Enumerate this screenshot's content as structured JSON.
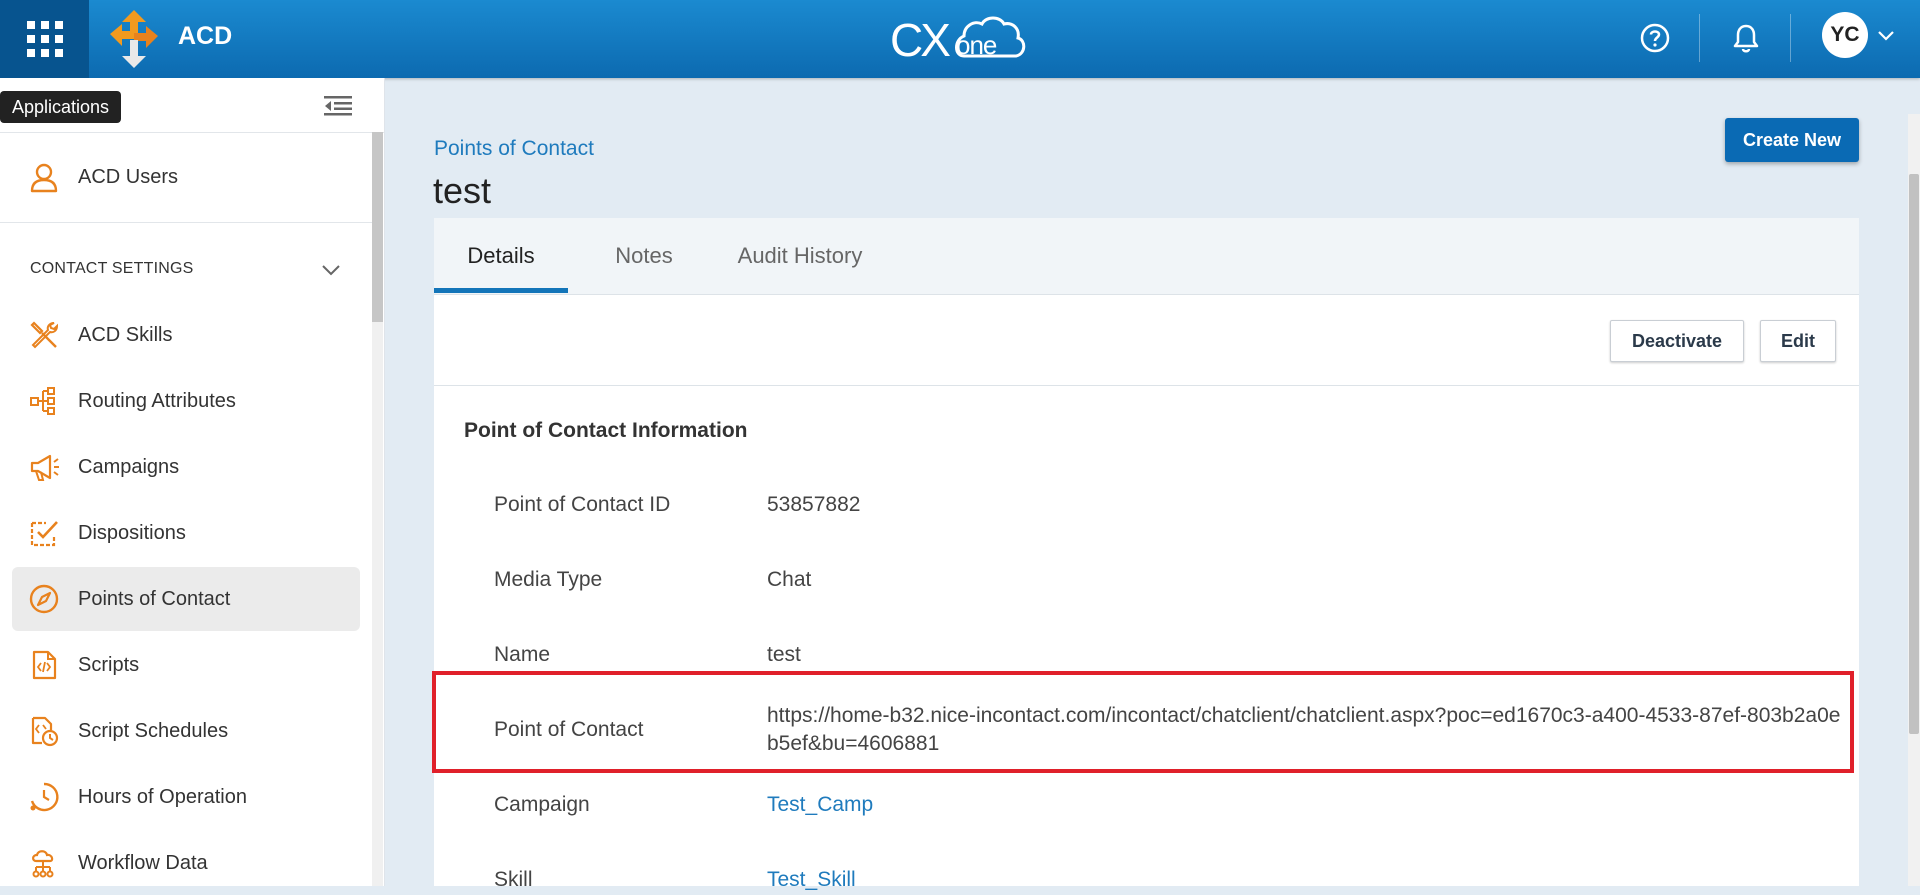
{
  "header": {
    "app_name": "ACD",
    "logo_text": "CXone",
    "avatar_initials": "YC",
    "apps_tooltip": "Applications"
  },
  "sidebar": {
    "top_item": "ACD Users",
    "section_header": "CONTACT SETTINGS",
    "items": [
      {
        "label": "ACD Skills",
        "icon": "skills-tools-icon"
      },
      {
        "label": "Routing Attributes",
        "icon": "routing-tree-icon"
      },
      {
        "label": "Campaigns",
        "icon": "megaphone-icon"
      },
      {
        "label": "Dispositions",
        "icon": "checklist-icon"
      },
      {
        "label": "Points of Contact",
        "icon": "compass-icon",
        "active": true
      },
      {
        "label": "Scripts",
        "icon": "script-file-icon"
      },
      {
        "label": "Script Schedules",
        "icon": "script-schedule-icon"
      },
      {
        "label": "Hours of Operation",
        "icon": "clock-icon"
      },
      {
        "label": "Workflow Data",
        "icon": "workflow-cloud-icon"
      }
    ]
  },
  "main": {
    "breadcrumb": "Points of Contact",
    "title": "test",
    "create_button": "Create New",
    "tabs": [
      "Details",
      "Notes",
      "Audit History"
    ],
    "deactivate_button": "Deactivate",
    "edit_button": "Edit",
    "section_title": "Point of Contact Information",
    "fields": [
      {
        "label": "Point of Contact ID",
        "value": "53857882"
      },
      {
        "label": "Media Type",
        "value": "Chat"
      },
      {
        "label": "Name",
        "value": "test"
      },
      {
        "label": "Point of Contact",
        "value": "https://home-b32.nice-incontact.com/incontact/chatclient/chatclient.aspx?poc=ed1670c3-a400-4533-87ef-803b2a0eb5ef&bu=4606881"
      },
      {
        "label": "Campaign",
        "value": "Test_Camp",
        "link": true
      },
      {
        "label": "Skill",
        "value": "Test_Skill",
        "link": true
      }
    ]
  },
  "colors": {
    "header_blue": "#0c6ab0",
    "accent_orange": "#e8821e",
    "link_blue": "#1f7bbd",
    "highlight_red": "#e0202a"
  }
}
